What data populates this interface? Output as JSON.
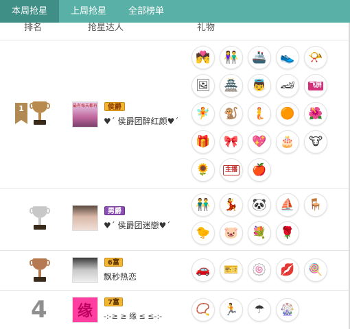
{
  "tabs": [
    {
      "label": "本周抢星",
      "active": true
    },
    {
      "label": "上周抢星",
      "active": false
    },
    {
      "label": "全部榜单",
      "active": false
    }
  ],
  "headers": {
    "rank": "排名",
    "user": "抢星达人",
    "gifts": "礼物"
  },
  "rows": [
    {
      "rank": "1",
      "badge": "侯爵",
      "name": "♥ˊ 侯爵团醉红颜♥ˊ",
      "avatar_text": "最有每天都有",
      "gifts": [
        "couple-gift",
        "couple-gift-2",
        "tank-gift",
        "sneaker-gift",
        "horn-gift",
        "photo-frame-gift",
        "pavilion-gift",
        "angel-gift",
        "race-car-gift",
        "fly-screen-gift",
        "doll-gift",
        "monkey-gift",
        "mermaid-gift",
        "orange-ball-gift",
        "red-rose-gift",
        "purple-box-gift",
        "bow-gift",
        "heart-gift",
        "cake-gift",
        "cow-doll-gift",
        "sunflower-gift",
        "signboard-gift",
        "apple-gift"
      ],
      "gift_labels": {
        "fly-screen-gift": "飞屏",
        "signboard-gift": "主播"
      }
    },
    {
      "rank": "",
      "badge": "男爵",
      "name": "♥ˊ 侯爵团迷戀♥ˊ",
      "gifts": [
        "couple-gift-3",
        "dancer-gift",
        "panda-gift",
        "boat-gift",
        "red-chair-gift",
        "duck-gift",
        "pig-gift",
        "rose-bunch-gift",
        "rose-gift"
      ]
    },
    {
      "rank": "",
      "badge": "6富",
      "name": "飘秒热恋",
      "gifts": [
        "sports-car-gift",
        "ticket-gift",
        "cotton-candy-gift",
        "lips-gift",
        "lollipop-gift"
      ]
    },
    {
      "rank": "4",
      "badge": "7富",
      "name": "-:-≥ ≥ 缘 ≤ ≤-:-",
      "avatar_text": "缘",
      "gifts": [
        "necklace-gift",
        "runner-gift",
        "umbrella-gift",
        "pinwheel-gift"
      ]
    }
  ],
  "colors": {
    "tab_bar": "#59b0a7",
    "tab_active": "#3f8f87",
    "badge_gold": "#f2b632",
    "badge_purple": "#8a4fb0",
    "badge_green": "#6a9a3a"
  }
}
